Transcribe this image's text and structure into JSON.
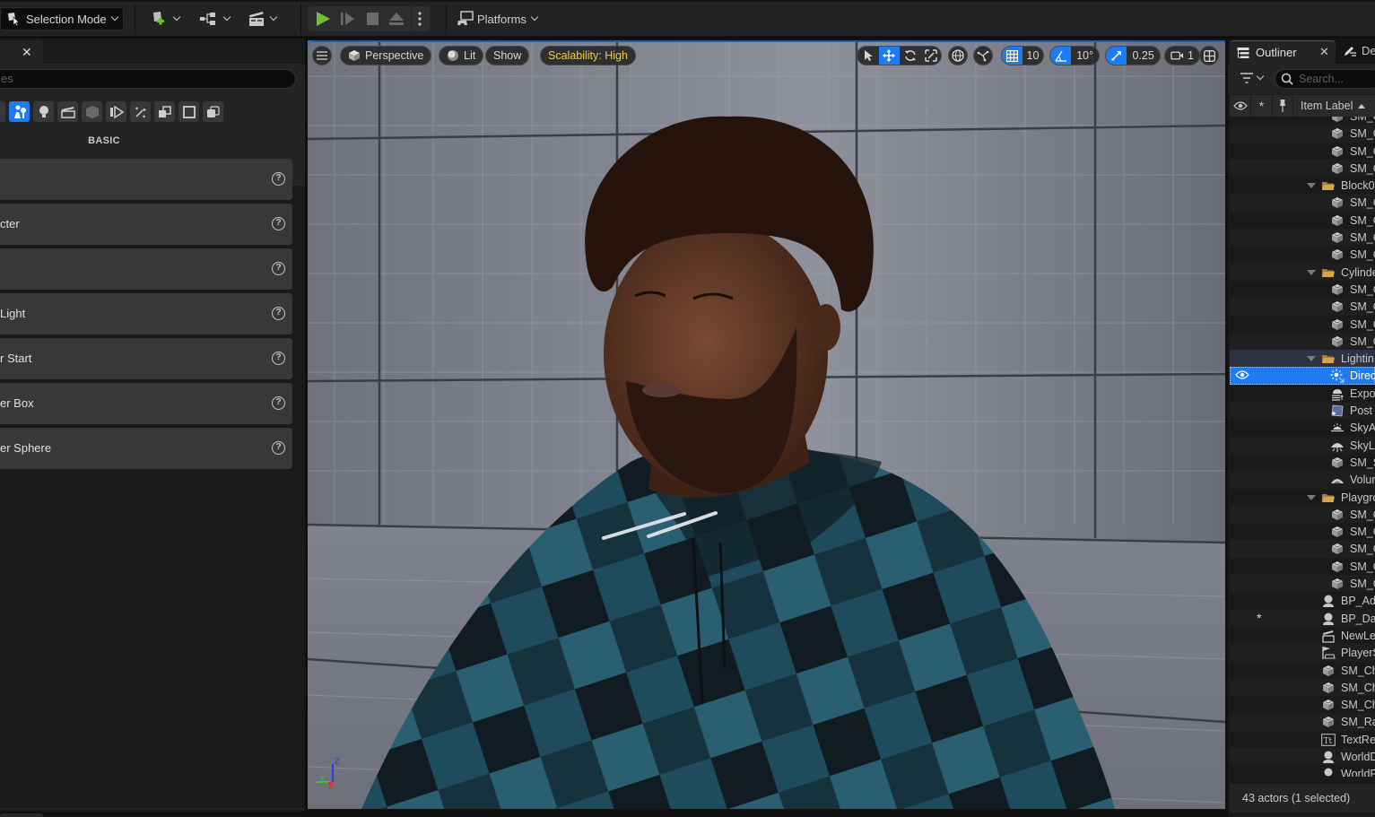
{
  "toolbar": {
    "selection_mode_label": "Selection Mode",
    "platforms_label": "Platforms",
    "icons": [
      "selection-mode-icon",
      "add-actor-icon",
      "blueprint-icon",
      "cinematics-icon",
      "play-icon",
      "advance-frame-icon",
      "stop-icon",
      "eject-icon",
      "more-options-icon",
      "platforms-icon"
    ],
    "play_color": "#6fbf33"
  },
  "left_panel": {
    "search_placeholder_visible": "es",
    "category_label": "BASIC",
    "actors": [
      {
        "label": ""
      },
      {
        "label": "cter"
      },
      {
        "label": ""
      },
      {
        "label": "Light"
      },
      {
        "label": "r Start"
      },
      {
        "label": "er Box"
      },
      {
        "label": "er Sphere"
      }
    ],
    "categories": [
      "recently-placed",
      "basic",
      "lights",
      "cinematic",
      "visual-effects-volume",
      "geometry",
      "volumes",
      "all-classes",
      "shapes",
      "box",
      "layers"
    ]
  },
  "viewport": {
    "perspective_label": "Perspective",
    "lit_label": "Lit",
    "show_label": "Show",
    "scalability_label": "Scalability: High",
    "grid_snap_value": "10",
    "rotation_snap_value": "10°",
    "scale_snap_value": "0.25",
    "camera_speed_value": "1",
    "axis_labels": {
      "x": "X",
      "y": "Y",
      "z": "Z"
    },
    "accent_color": "#1d7cf2",
    "scalability_color": "#f2cf2e"
  },
  "outliner": {
    "tab_label": "Outliner",
    "details_tab_label": "De",
    "search_placeholder": "Search...",
    "column_item_label": "Item Label",
    "rows": [
      {
        "indent": 3,
        "type": "mesh",
        "label": "SM_C"
      },
      {
        "indent": 3,
        "type": "mesh",
        "label": "SM_C"
      },
      {
        "indent": 3,
        "type": "mesh",
        "label": "SM_C"
      },
      {
        "indent": 3,
        "type": "mesh",
        "label": "SM_C"
      },
      {
        "indent": 2,
        "type": "folder",
        "label": "Block0"
      },
      {
        "indent": 3,
        "type": "mesh",
        "label": "SM_C"
      },
      {
        "indent": 3,
        "type": "mesh",
        "label": "SM_C"
      },
      {
        "indent": 3,
        "type": "mesh",
        "label": "SM_C"
      },
      {
        "indent": 3,
        "type": "mesh",
        "label": "SM_C"
      },
      {
        "indent": 2,
        "type": "folder",
        "label": "Cylinde"
      },
      {
        "indent": 3,
        "type": "mesh",
        "label": "SM_C"
      },
      {
        "indent": 3,
        "type": "mesh",
        "label": "SM_C"
      },
      {
        "indent": 3,
        "type": "mesh",
        "label": "SM_C"
      },
      {
        "indent": 3,
        "type": "mesh",
        "label": "SM_C"
      },
      {
        "indent": 2,
        "type": "folder",
        "label": "Lightin",
        "highlight": true
      },
      {
        "indent": 3,
        "type": "directional-light",
        "label": "Direc",
        "selected": true
      },
      {
        "indent": 3,
        "type": "exponential-fog",
        "label": "Expo"
      },
      {
        "indent": 3,
        "type": "post-process",
        "label": "Post"
      },
      {
        "indent": 3,
        "type": "sky-atmosphere",
        "label": "SkyA"
      },
      {
        "indent": 3,
        "type": "sky-light",
        "label": "SkyL"
      },
      {
        "indent": 3,
        "type": "mesh",
        "label": "SM_S"
      },
      {
        "indent": 3,
        "type": "volumetric-cloud",
        "label": "Volur"
      },
      {
        "indent": 2,
        "type": "folder",
        "label": "Playgro"
      },
      {
        "indent": 3,
        "type": "mesh",
        "label": "SM_C"
      },
      {
        "indent": 3,
        "type": "mesh",
        "label": "SM_C"
      },
      {
        "indent": 3,
        "type": "mesh",
        "label": "SM_C"
      },
      {
        "indent": 3,
        "type": "mesh",
        "label": "SM_C"
      },
      {
        "indent": 3,
        "type": "mesh",
        "label": "SM_C"
      },
      {
        "indent": 2,
        "type": "actor",
        "label": "BP_Ada"
      },
      {
        "indent": 2,
        "type": "actor",
        "label": "BP_Da",
        "starred": true
      },
      {
        "indent": 2,
        "type": "level-sequence",
        "label": "NewLe"
      },
      {
        "indent": 2,
        "type": "player-start",
        "label": "PlayerS"
      },
      {
        "indent": 2,
        "type": "mesh",
        "label": "SM_Ch"
      },
      {
        "indent": 2,
        "type": "mesh",
        "label": "SM_Ch"
      },
      {
        "indent": 2,
        "type": "mesh",
        "label": "SM_Ch"
      },
      {
        "indent": 2,
        "type": "mesh",
        "label": "SM_Ra"
      },
      {
        "indent": 2,
        "type": "text-render",
        "label": "TextRe"
      },
      {
        "indent": 2,
        "type": "actor",
        "label": "WorldD"
      },
      {
        "indent": 2,
        "type": "actor",
        "label": "WorldP"
      }
    ],
    "footer_status": "43 actors (1 selected)",
    "folder_color": "#c99a4e",
    "selected_color": "#1d7cf2"
  }
}
